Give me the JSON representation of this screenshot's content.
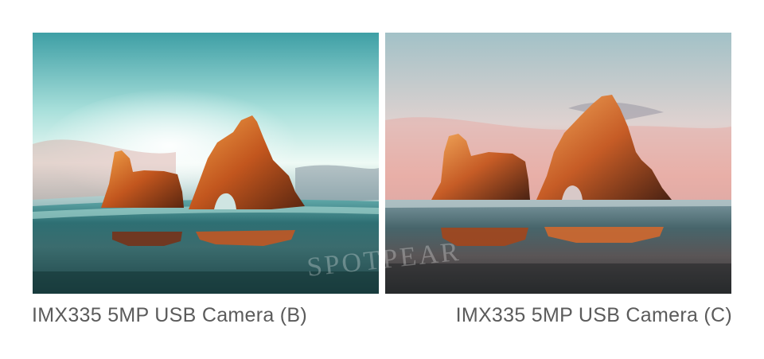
{
  "images": [
    {
      "id": "b",
      "caption": "IMX335 5MP USB Camera (B)",
      "scene": "sea-arch-rocks-sunset",
      "palette": {
        "sky_top": "#4fb0b0",
        "sky_mid": "#dff4ee",
        "rock": "#c35a22",
        "sea": "#2f6f70"
      }
    },
    {
      "id": "c",
      "caption": "IMX335 5MP USB Camera (C)",
      "scene": "sea-arch-rocks-sunset",
      "palette": {
        "sky_top": "#a5c2c8",
        "sky_mid": "#e8b8b0",
        "rock": "#c9602a",
        "sea": "#3d5c62"
      }
    }
  ],
  "watermark": "SPOTPEAR"
}
